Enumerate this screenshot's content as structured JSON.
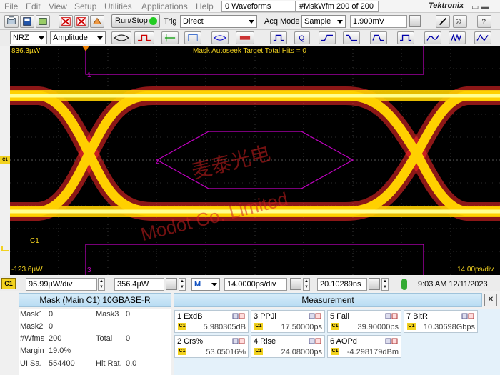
{
  "menu": [
    "File",
    "Edit",
    "View",
    "Setup",
    "Utilities",
    "Applications",
    "Help"
  ],
  "waveforms_count": "0 Waveforms",
  "mask_wfm": "#MskWfm  200 of 200",
  "brand": "Tektronix",
  "toolbar": {
    "run_stop": "Run/Stop",
    "trig_label": "Trig",
    "trig_value": "Direct",
    "acq_label": "Acq Mode",
    "acq_value": "Sample",
    "level_value": "1.900mV"
  },
  "toolbar2": {
    "coding": "NRZ",
    "measure_type": "Amplitude"
  },
  "scope": {
    "top_value": "836.3µW",
    "bottom_value": "-123.6µW",
    "mask_status": "Mask Autoseek Target Total Hits = 0",
    "channel": "C1",
    "time_per_div": "14.00ps/div",
    "region1": "1",
    "region2": "2",
    "region3": "3",
    "watermark_cn": "麦泰光电",
    "watermark_en": "Modot  Co. Limited",
    "trace_color": "#ffd000"
  },
  "controls": {
    "channel": "C1",
    "vertical_scale": "95.99µW/div",
    "vertical_offset": "356.4µW",
    "time_mode": "M",
    "time_scale": "14.0000ps/div",
    "position": "20.10289ns",
    "datetime": "9:03 AM 12/11/2023"
  },
  "mask_panel": {
    "title": "Mask (Main  C1) 10GBASE-R",
    "rows": [
      {
        "l1": "Mask1",
        "v1": "0",
        "l2": "Mask3",
        "v2": "0"
      },
      {
        "l1": "Mask2",
        "v1": "0",
        "l2": "",
        "v2": ""
      },
      {
        "l1": "#Wfms",
        "v1": "200",
        "l2": "Total",
        "v2": "0"
      },
      {
        "l1": "Margin",
        "v1": "19.0%",
        "l2": "",
        "v2": ""
      },
      {
        "l1": "UI Sa.",
        "v1": "554400",
        "l2": "Hit Rat.",
        "v2": "0.0"
      }
    ]
  },
  "measurement": {
    "title": "Measurement",
    "items": [
      {
        "name": "1 ExdB",
        "value": "5.980305dB"
      },
      {
        "name": "3 PPJi",
        "value": "17.50000ps"
      },
      {
        "name": "5 Fall",
        "value": "39.90000ps"
      },
      {
        "name": "7 BitR",
        "value": "10.30698Gbps"
      },
      {
        "name": "2 Crs%",
        "value": "53.05016%"
      },
      {
        "name": "4 Rise",
        "value": "24.08000ps"
      },
      {
        "name": "6 AOPd",
        "value": "-4.298179dBm"
      }
    ],
    "tag": "C1"
  }
}
